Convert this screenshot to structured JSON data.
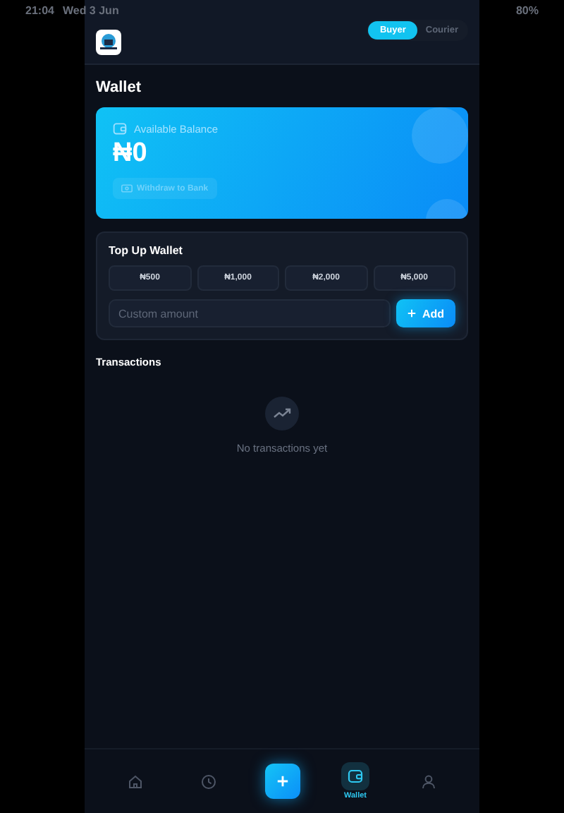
{
  "status_bar": {
    "time": "21:04",
    "date": "Wed 3 Jun",
    "battery": "80%"
  },
  "role_tabs": [
    {
      "label": "Buyer",
      "selected": true
    },
    {
      "label": "Courier",
      "selected": false
    }
  ],
  "page_title": "Wallet",
  "balance_card": {
    "label": "Available Balance",
    "amount": "₦0",
    "withdraw_button": {
      "label": "Withdraw to Bank",
      "disabled": true
    }
  },
  "top_up": {
    "title": "Top Up Wallet",
    "amounts": [
      "₦500",
      "₦1,000",
      "₦2,000",
      "₦5,000"
    ],
    "custom_amount": {
      "placeholder": "Custom amount"
    },
    "add_button": "Add"
  },
  "transactions": {
    "title": "Transactions",
    "empty_text": "No transactions yet"
  },
  "bottom_nav": [
    {
      "kind": "home",
      "selected": false
    },
    {
      "kind": "history",
      "selected": false
    },
    {
      "kind": "create",
      "selected": false
    },
    {
      "kind": "wallet",
      "selected": true,
      "label": "Wallet"
    },
    {
      "kind": "profile",
      "selected": false
    }
  ]
}
